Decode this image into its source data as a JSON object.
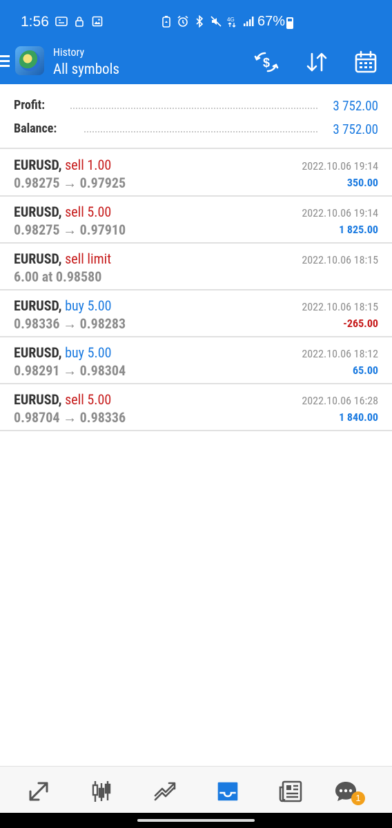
{
  "status_bar": {
    "time": "1:56",
    "battery_percent": "67%",
    "battery_level": 0.67,
    "network": "4G"
  },
  "header": {
    "subtitle": "History",
    "title": "All symbols",
    "icons": [
      "menu-icon",
      "app-logo",
      "currency-exchange-icon",
      "sort-icon",
      "calendar-icon"
    ]
  },
  "summary": {
    "profit_label": "Profit:",
    "profit_value": "3 752.00",
    "balance_label": "Balance:",
    "balance_value": "3 752.00"
  },
  "deals": [
    {
      "symbol": "EURUSD",
      "type": "sell 1.00",
      "side": "sell",
      "prices": "0.98275 → 0.97925",
      "time": "2022.10.06 19:14",
      "profit": "350.00"
    },
    {
      "symbol": "EURUSD",
      "type": "sell 5.00",
      "side": "sell",
      "prices": "0.98275 → 0.97910",
      "time": "2022.10.06 19:14",
      "profit": "1 825.00"
    },
    {
      "symbol": "EURUSD",
      "type": "sell limit",
      "side": "sell",
      "prices": "6.00 at 0.98580",
      "time": "2022.10.06 18:15",
      "profit": ""
    },
    {
      "symbol": "EURUSD",
      "type": "buy 5.00",
      "side": "buy",
      "prices": "0.98336 → 0.98283",
      "time": "2022.10.06 18:15",
      "profit": "-265.00"
    },
    {
      "symbol": "EURUSD",
      "type": "buy 5.00",
      "side": "buy",
      "prices": "0.98291 → 0.98304",
      "time": "2022.10.06 18:12",
      "profit": "65.00"
    },
    {
      "symbol": "EURUSD",
      "type": "sell 5.00",
      "side": "sell",
      "prices": "0.98704 → 0.98336",
      "time": "2022.10.06 16:28",
      "profit": "1 840.00"
    }
  ],
  "bottom_nav": {
    "items": [
      "quotes-icon",
      "chart-icon",
      "trade-icon",
      "history-icon",
      "news-icon",
      "messages-icon"
    ],
    "active": "history-icon",
    "messages_badge": "1"
  },
  "colors": {
    "accent": "#1a7ae0",
    "sell": "#c61a1a",
    "buy": "#1a7ae0",
    "badge": "#f2a01b"
  }
}
